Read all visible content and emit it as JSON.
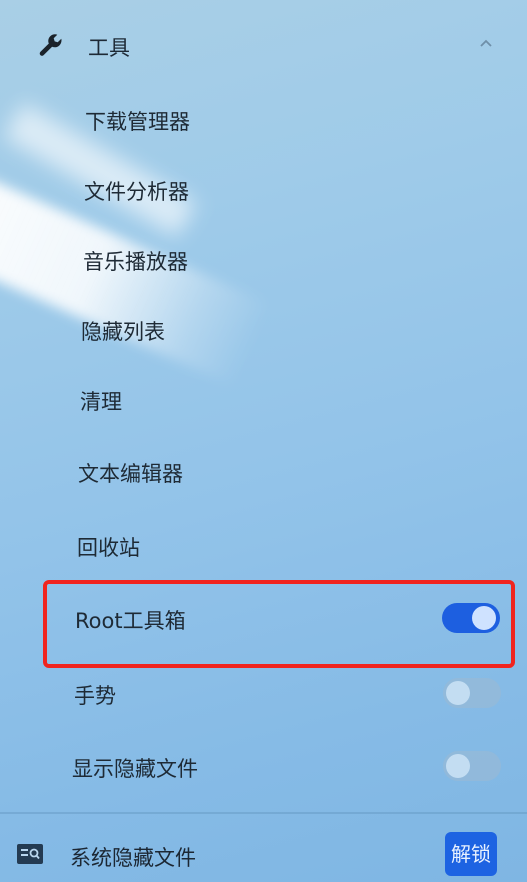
{
  "section": {
    "title": "工具",
    "icon": "wrench-icon",
    "expand_icon": "chevron-up-icon"
  },
  "menu_items": [
    {
      "label": "下载管理器"
    },
    {
      "label": "文件分析器"
    },
    {
      "label": "音乐播放器"
    },
    {
      "label": "隐藏列表"
    },
    {
      "label": "清理"
    },
    {
      "label": "文本编辑器"
    },
    {
      "label": "回收站"
    }
  ],
  "toggle_items": [
    {
      "label": "Root工具箱",
      "enabled": true
    },
    {
      "label": "手势",
      "enabled": false
    },
    {
      "label": "显示隐藏文件",
      "enabled": false
    }
  ],
  "bottom": {
    "icon": "list-search-icon",
    "label": "系统隐藏文件",
    "button_label": "解锁"
  },
  "colors": {
    "accent": "#1d5fe0",
    "highlight_border": "#f0241f",
    "toggle_off": "#a9c6dd"
  }
}
